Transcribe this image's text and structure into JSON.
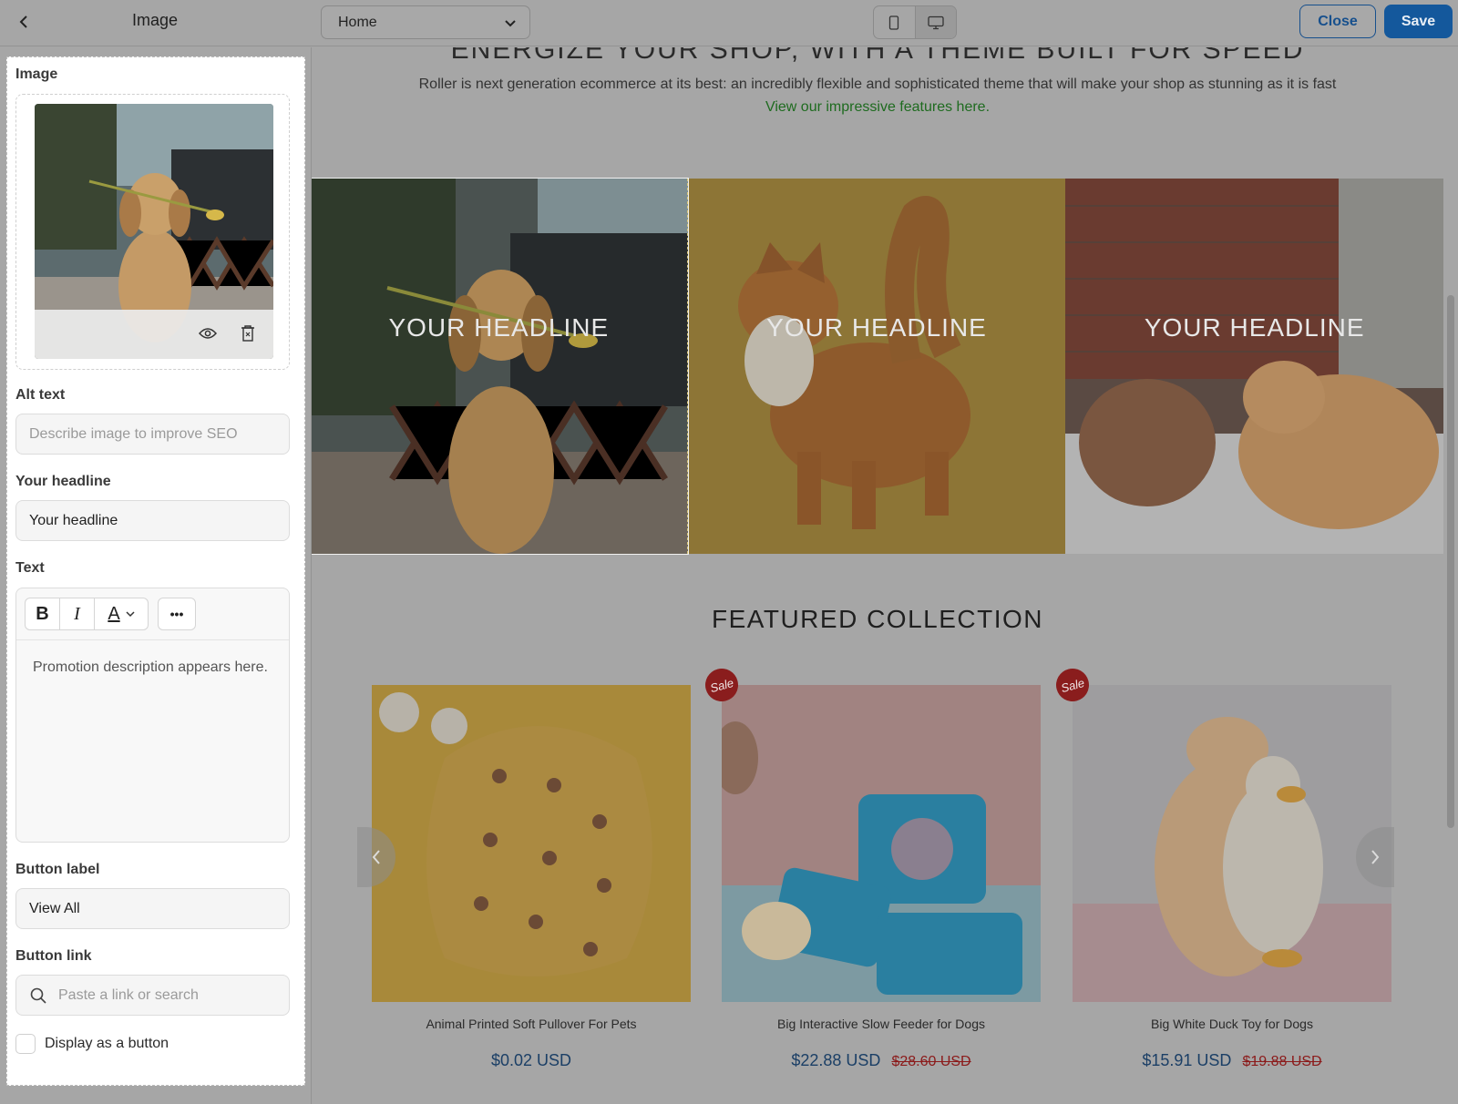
{
  "topbar": {
    "panel_title": "Image",
    "page_select": "Home",
    "close_label": "Close",
    "save_label": "Save"
  },
  "panel": {
    "image_label": "Image",
    "alt_label": "Alt text",
    "alt_placeholder": "Describe image to improve SEO",
    "headline_label": "Your headline",
    "headline_value": "Your headline",
    "text_label": "Text",
    "text_body": "Promotion description appears here.",
    "toolbar": {
      "bold": "B",
      "italic": "I",
      "color": "A",
      "more": "•••"
    },
    "button_label_label": "Button label",
    "button_label_value": "View All",
    "button_link_label": "Button link",
    "button_link_placeholder": "Paste a link or search",
    "display_as_button": "Display as a button"
  },
  "preview": {
    "hero_heading": "ENERGIZE YOUR SHOP, WITH A THEME BUILT FOR SPEED",
    "intro_text": "Roller is next generation ecommerce at its best: an incredibly flexible and sophisticated theme that will make your shop as stunning as it is fast",
    "intro_link": "View our impressive features here.",
    "tiles": [
      {
        "headline": "YOUR HEADLINE"
      },
      {
        "headline": "YOUR HEADLINE"
      },
      {
        "headline": "YOUR HEADLINE"
      }
    ],
    "featured_title": "FEATURED COLLECTION",
    "products": [
      {
        "name": "Animal Printed Soft Pullover For Pets",
        "price": "$0.02 USD",
        "old_price": ""
      },
      {
        "name": "Big Interactive Slow Feeder for Dogs",
        "price": "$22.88 USD",
        "old_price": "$28.60 USD",
        "badge": "Sale"
      },
      {
        "name": "Big White Duck Toy for Dogs",
        "price": "$15.91 USD",
        "old_price": "$19.88 USD",
        "badge": "Sale"
      }
    ]
  },
  "colors": {
    "accent": "#14589c",
    "link": "#1e6b1f",
    "sale": "#8a1d1d"
  },
  "icons": [
    "chevron-left-icon",
    "chevron-down-icon",
    "mobile-icon",
    "desktop-icon",
    "eye-icon",
    "delete-icon",
    "search-icon"
  ]
}
